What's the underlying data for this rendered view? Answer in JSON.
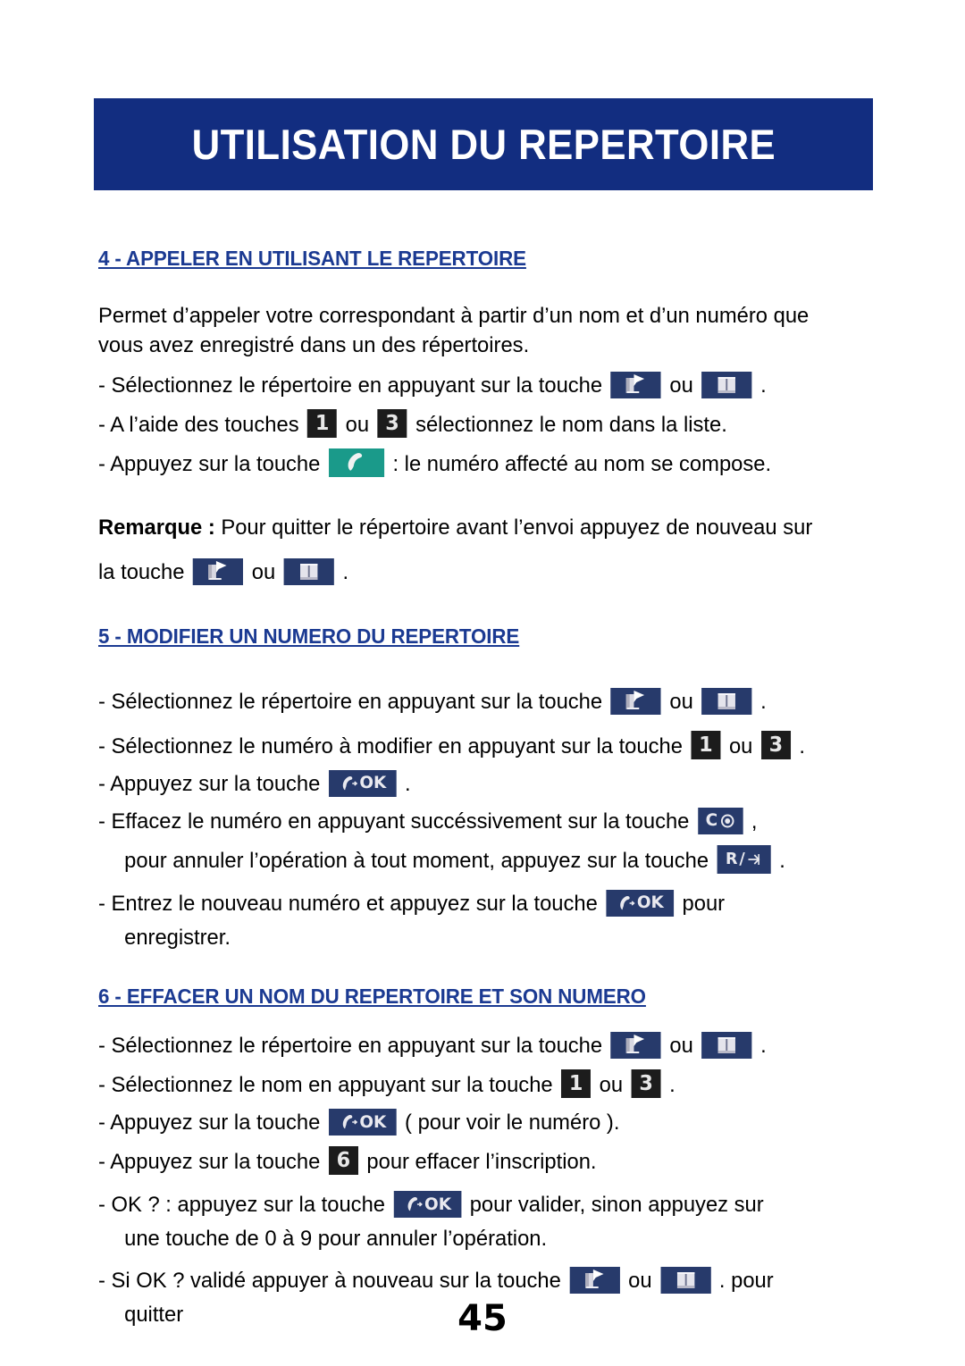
{
  "banner": {
    "title": "UTILISATION DU REPERTOIRE",
    "background_color": "#122d80",
    "text_color": "#ffffff"
  },
  "theme": {
    "heading_color": "#1b3a92",
    "key_navy": "#273a6b",
    "key_dark": "#1c1c1c",
    "key_green": "#1a9a8a",
    "page_background": "#ffffff",
    "body_text_color": "#000000"
  },
  "sections": [
    {
      "heading": "4 - APPELER EN UTILISANT LE REPERTOIRE",
      "intro": "Permet d’appeler votre correspondant à partir d’un nom et d’un numéro que vous avez enregistré dans un des répertoires.",
      "bullets": [
        {
          "prefix": "- Sélectionnez le répertoire en appuyant sur la touche",
          "key1": "book-flag-key",
          "sep": "ou",
          "key2": "book-open-key",
          "suffix": "."
        },
        {
          "prefix": "- A l’aide des  touches",
          "key1": "digit-1-key",
          "sep": "ou",
          "key2": "digit-3-key",
          "suffix": "sélectionnez le nom dans la liste."
        },
        {
          "prefix": "- Appuyez sur la touche",
          "key1": "call-key",
          "suffix": ": le numéro affecté au nom se compose."
        }
      ],
      "note": {
        "label": "Remarque :",
        "text": "Pour quitter le répertoire avant l’envoi  appuyez de nouveau sur",
        "line2_prefix": "la touche",
        "key1": "book-flag-key",
        "sep": "ou",
        "key2": "book-open-key",
        "suffix": "."
      }
    },
    {
      "heading": "5 - MODIFIER UN NUMERO DU REPERTOIRE",
      "bullets": [
        {
          "prefix": "- Sélectionnez le répertoire en appuyant sur la touche",
          "key1": "book-flag-key",
          "sep": "ou",
          "key2": "book-open-key",
          "suffix": "."
        },
        {
          "prefix": "- Sélectionnez le numéro à modifier en appuyant sur la touche",
          "key1": "digit-1-key",
          "sep": "ou",
          "key2": "digit-3-key",
          "suffix": "."
        },
        {
          "prefix": "- Appuyez sur la touche",
          "key1": "ok-key",
          "suffix": "."
        },
        {
          "prefix": "- Effacez le numéro en appuyant succéssivement sur la touche",
          "key1": "c-erase-key",
          "suffix": ","
        },
        {
          "prefix": "pour annuler l’opération à tout moment, appuyez sur la touche",
          "key1": "r-arrow-key",
          "suffix": ".",
          "indented": true
        },
        {
          "prefix": "- Entrez le nouveau numéro et appuyez sur la touche",
          "key1": "ok-key",
          "suffix": "pour"
        },
        {
          "prefix": "enregistrer.",
          "indented": true
        }
      ]
    },
    {
      "heading": "6 - EFFACER UN NOM DU REPERTOIRE ET SON NUMERO",
      "bullets": [
        {
          "prefix": "- Sélectionnez le répertoire en appuyant sur la touche",
          "key1": "book-flag-key",
          "sep": "ou",
          "key2": "book-open-key",
          "suffix": "."
        },
        {
          "prefix": "- Sélectionnez le nom en appuyant sur la touche",
          "key1": "digit-1-key",
          "sep": "ou",
          "key2": "digit-3-key",
          "suffix": "."
        },
        {
          "prefix": "- Appuyez sur la touche",
          "key1": "ok-key",
          "suffix": "( pour voir le numéro )."
        },
        {
          "prefix": "- Appuyez sur la touche",
          "key1": "digit-6-key",
          "suffix": "pour effacer l’inscription."
        },
        {
          "prefix": "- OK ? : appuyez sur la touche",
          "key1": "ok-key",
          "suffix": "pour valider, sinon appuyez sur"
        },
        {
          "prefix": "une touche de 0 à 9 pour annuler l’opération.",
          "indented": true
        },
        {
          "prefix": "- Si OK ? validé appuyer à nouveau sur la touche",
          "key1": "book-flag-key",
          "sep": "ou",
          "key2": "book-open-key",
          "suffix": ". pour"
        },
        {
          "prefix": "quitter",
          "indented": true
        }
      ]
    }
  ],
  "keys": {
    "digit_1": "1",
    "digit_3": "3",
    "digit_6": "6",
    "ok_label": "OK",
    "c_label": "C",
    "r_label": "R"
  },
  "footer": {
    "page_number": "45"
  }
}
